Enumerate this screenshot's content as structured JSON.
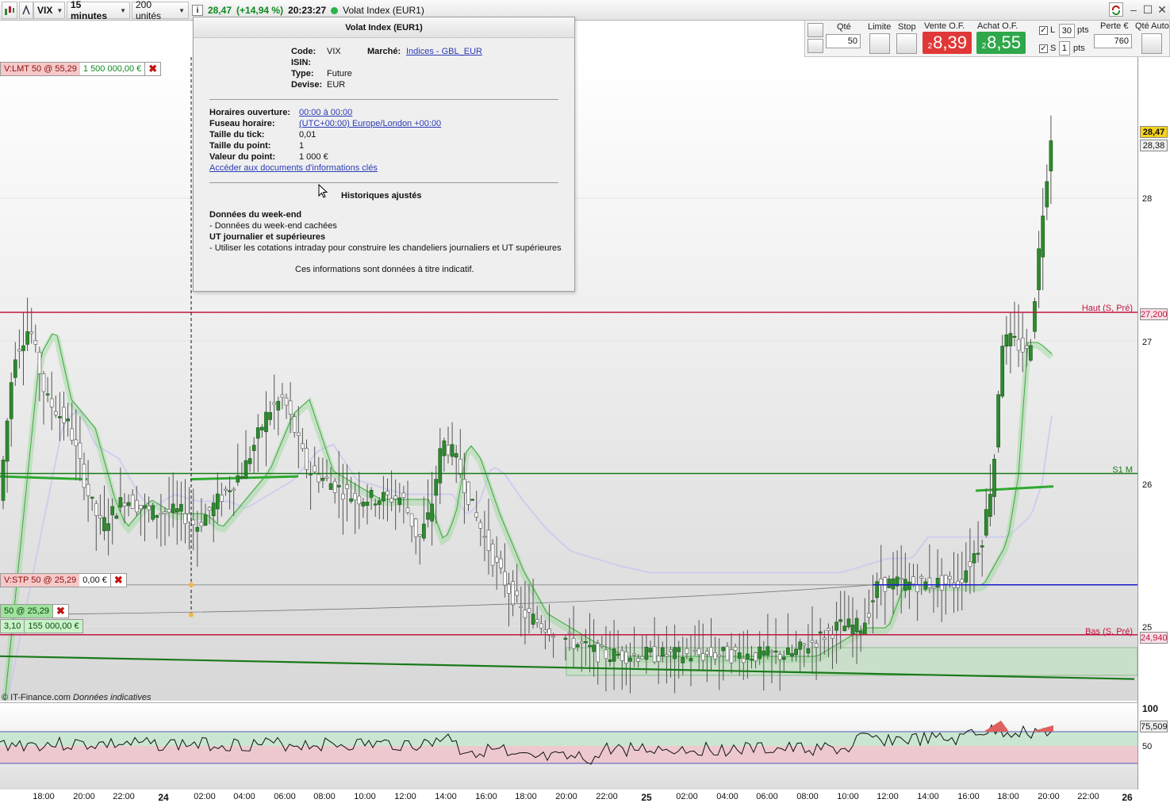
{
  "toolbar": {
    "symbol": "VIX",
    "timeframe": "15 minutes",
    "units": "200 unités",
    "last_price": "28,47",
    "change": "(+14,94 %)",
    "time": "20:23:27",
    "instrument": "Volat Index (EUR1)"
  },
  "order_panel": {
    "qty_label": "Qté",
    "qty_value": "50",
    "limit_label": "Limite",
    "stop_label": "Stop",
    "sell_label": "Vente O.F.",
    "buy_label": "Achat O.F.",
    "sell_prefix": "2",
    "sell_price": "8,39",
    "buy_prefix": "2",
    "buy_price": "8,55",
    "l_label": "L",
    "l_value": "30",
    "s_label": "S",
    "s_value": "1",
    "pts": "pts",
    "loss_label": "Perte €",
    "loss_value": "760",
    "auto_qty_label": "Qté Auto"
  },
  "orders": {
    "limit_order": "V:LMT  50 @ 55,29",
    "limit_amount": "1 500 000,00 €",
    "stop_order": "V:STP  50 @ 25,29",
    "stop_amount": "0,00 €",
    "position": "50 @ 25,29",
    "position_pnl": "3,10",
    "position_amount": "155 000,00 €"
  },
  "info_popup": {
    "title": "Volat Index (EUR1)",
    "code_label": "Code:",
    "code": "VIX",
    "market_label": "Marché:",
    "market": "Indices - GBL_EUR",
    "isin_label": "ISIN:",
    "type_label": "Type:",
    "type": "Future",
    "currency_label": "Devise:",
    "currency": "EUR",
    "hours_label": "Horaires ouverture:",
    "hours": "00:00 à 00:00",
    "tz_label": "Fuseau horaire:",
    "tz": "(UTC+00:00) Europe/London +00:00",
    "tick_label": "Taille du tick:",
    "tick": "0,01",
    "point_label": "Taille du point:",
    "point": "1",
    "point_value_label": "Valeur du point:",
    "point_value": "1 000 €",
    "docs_link": "Accéder aux documents d'informations clés",
    "adjusted": "Historiques ajustés",
    "weekend_title": "Données du week-end",
    "weekend_text": "- Données du week-end cachées",
    "daily_title": "UT journalier et supérieures",
    "daily_text": "- Utiliser les cotations intraday pour construire les chandeliers journaliers et UT supérieures",
    "disclaimer": "Ces informations sont données à titre indicatif."
  },
  "levels": {
    "high_label": "Haut (S, Pré)",
    "high_value": "27,200",
    "low_label": "Bas (S, Pré)",
    "low_value": "24,940",
    "s1_label": "S1 M",
    "last_tag": "28,47",
    "prev_tag": "28,38"
  },
  "price_axis": [
    "28",
    "27",
    "26",
    "25"
  ],
  "indicator": {
    "top": "100",
    "value": "75,509",
    "mid": "50"
  },
  "credit": "© IT-Finance.com",
  "credit_note": "Données indicatives",
  "time_axis": [
    "18:00",
    "20:00",
    "22:00",
    "24",
    "02:00",
    "04:00",
    "06:00",
    "08:00",
    "10:00",
    "12:00",
    "14:00",
    "16:00",
    "18:00",
    "20:00",
    "22:00",
    "25",
    "02:00",
    "04:00",
    "06:00",
    "08:00",
    "10:00",
    "12:00",
    "14:00",
    "16:00",
    "18:00",
    "20:00",
    "22:00",
    "26"
  ],
  "colors": {
    "up_candle": "#2e8b2e",
    "down_candle": "#ffffff",
    "resistance": "#c0143c",
    "support_s1": "#1a7a1a",
    "stop_line": "#1a1ad0",
    "sell_btn": "#e03838",
    "buy_btn": "#2ea84a"
  }
}
